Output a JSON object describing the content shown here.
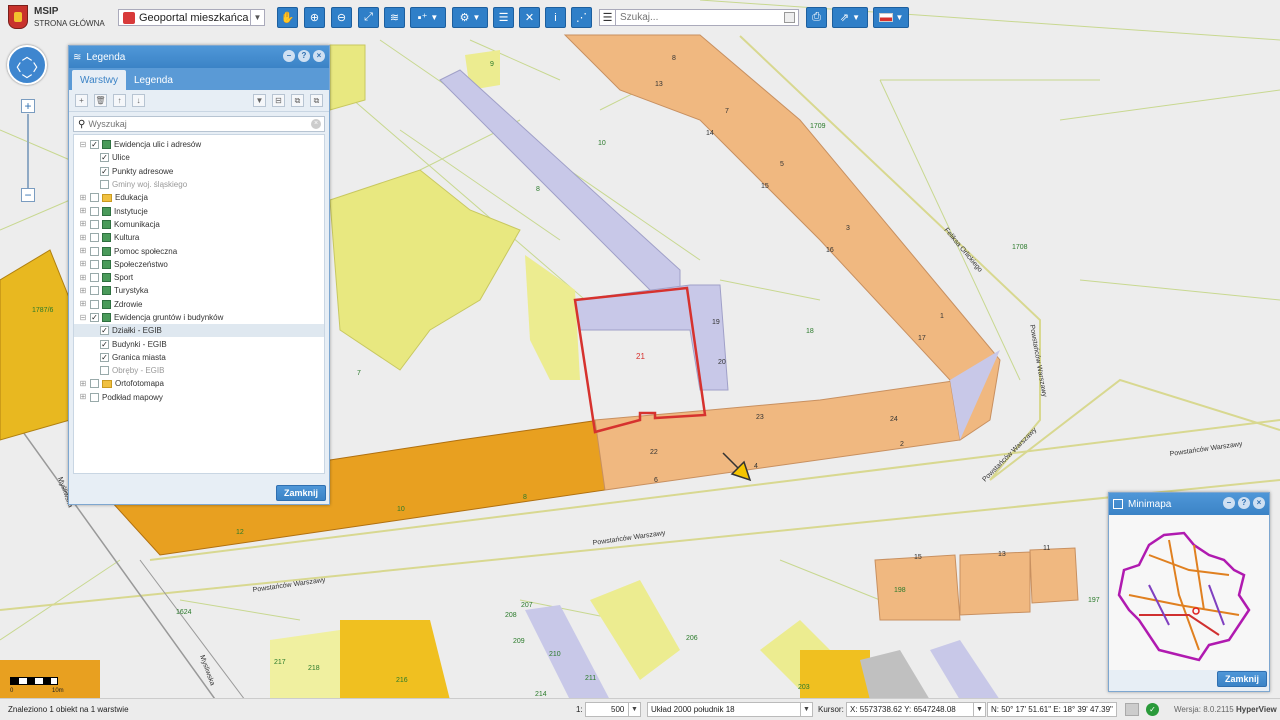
{
  "app": {
    "title": "MSIP",
    "subtitle": "STRONA GŁÓWNA"
  },
  "toolbar": {
    "portal": "Geoportal mieszkańca",
    "search_placeholder": "Szukaj...",
    "icons": [
      "hand-pan-icon",
      "zoom-in-icon",
      "zoom-out-icon",
      "full-extent-icon",
      "layers-icon",
      "add-layer-icon",
      "tools-icon",
      "table-icon",
      "clear-icon",
      "info-icon",
      "share-icon",
      "print-icon",
      "export-icon",
      "language-flag-icon"
    ]
  },
  "legend": {
    "title": "Legenda",
    "tabs": [
      "Warstwy",
      "Legenda"
    ],
    "search_placeholder": "Wyszukaj",
    "close_label": "Zamknij",
    "items": [
      {
        "label": "Ewidencja ulic i adresów",
        "level": 0,
        "checked": true,
        "expanded": true,
        "icon": "layer"
      },
      {
        "label": "Ulice",
        "level": 1,
        "checked": true
      },
      {
        "label": "Punkty adresowe",
        "level": 1,
        "checked": true
      },
      {
        "label": "Gminy woj. śląskiego",
        "level": 1,
        "checked": false,
        "gray": true
      },
      {
        "label": "Edukacja",
        "level": 0,
        "checked": false,
        "icon": "folder"
      },
      {
        "label": "Instytucje",
        "level": 0,
        "checked": false,
        "icon": "layer"
      },
      {
        "label": "Komunikacja",
        "level": 0,
        "checked": false,
        "icon": "layer"
      },
      {
        "label": "Kultura",
        "level": 0,
        "checked": false,
        "icon": "layer"
      },
      {
        "label": "Pomoc społeczna",
        "level": 0,
        "checked": false,
        "icon": "layer"
      },
      {
        "label": "Społeczeństwo",
        "level": 0,
        "checked": false,
        "icon": "layer"
      },
      {
        "label": "Sport",
        "level": 0,
        "checked": false,
        "icon": "layer"
      },
      {
        "label": "Turystyka",
        "level": 0,
        "checked": false,
        "icon": "layer"
      },
      {
        "label": "Zdrowie",
        "level": 0,
        "checked": false,
        "icon": "layer"
      },
      {
        "label": "Ewidencja gruntów i budynków",
        "level": 0,
        "checked": true,
        "expanded": true,
        "icon": "layer"
      },
      {
        "label": "Działki - EGIB",
        "level": 1,
        "checked": true,
        "selected": true
      },
      {
        "label": "Budynki - EGIB",
        "level": 1,
        "checked": true
      },
      {
        "label": "Granica miasta",
        "level": 1,
        "checked": true
      },
      {
        "label": "Obręby - EGIB",
        "level": 1,
        "checked": false,
        "gray": true
      },
      {
        "label": "Ortofotomapa",
        "level": 0,
        "checked": false,
        "icon": "folder"
      },
      {
        "label": "Podkład mapowy",
        "level": 0,
        "checked": false
      }
    ]
  },
  "minimap": {
    "title": "Minimapa",
    "close_label": "Zamknij"
  },
  "map": {
    "streets": [
      "Powstańców Warszawy",
      "Powstańców Warszawy",
      "Powstańców Warszawy",
      "Powstańców Warszawy",
      "Feliksa Orlickiego",
      "Mysliwska"
    ],
    "parcel_labels": [
      "9",
      "10",
      "8",
      "7",
      "21",
      "19",
      "20",
      "22",
      "23",
      "24",
      "6",
      "4",
      "2",
      "1",
      "17",
      "16",
      "3",
      "15",
      "5",
      "14",
      "7",
      "13",
      "8",
      "1709",
      "1708",
      "18",
      "10",
      "12",
      "1787/6",
      "208",
      "207",
      "209",
      "210",
      "211",
      "214",
      "217",
      "218",
      "216",
      "206",
      "203",
      "1624",
      "198",
      "197",
      "15",
      "13",
      "11"
    ],
    "selected_parcel": "21",
    "scale_labels": [
      "0",
      "10m"
    ]
  },
  "status": {
    "found": "Znaleziono 1 obiekt na 1 warstwie",
    "scale_prefix": "1:",
    "scale": "500",
    "crs": "Układ 2000 południk 18",
    "cursor_label": "Kursor:",
    "cursor_xy": "X: 5573738.62  Y: 6547248.08",
    "cursor_geo": "N: 50° 17' 51.61\"  E: 18° 39' 47.39\"",
    "version": "Wersja: 8.0.2115",
    "brand": "HyperView"
  },
  "colors": {
    "accent": "#3b83c6",
    "selected_parcel": "#d6322e",
    "building_orange": "#f0b880",
    "building_dark": "#e8a020",
    "building_yellow": "#e8e880",
    "building_lilac": "#c8c8e8"
  }
}
